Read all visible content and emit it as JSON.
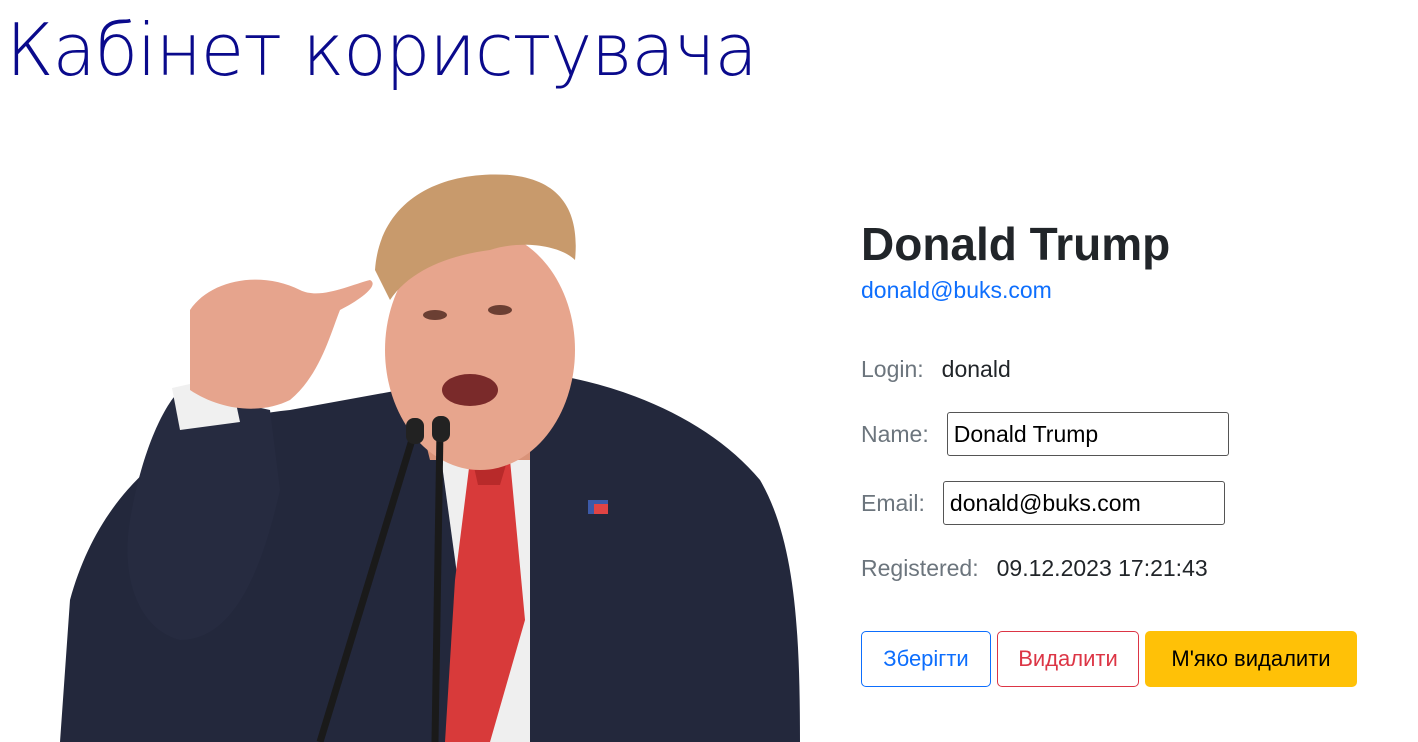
{
  "page": {
    "title": "Кабінет користувача"
  },
  "profile": {
    "name": "Donald Trump",
    "email_link": "donald@buks.com",
    "fields": {
      "login_label": "Login:",
      "login_value": "donald",
      "name_label": "Name:",
      "name_value": "Donald Trump",
      "email_label": "Email:",
      "email_value": "donald@buks.com",
      "registered_label": "Registered:",
      "registered_value": "09.12.2023 17:21:43"
    }
  },
  "actions": {
    "save_label": "Зберігти",
    "delete_label": "Видалити",
    "soft_delete_label": "М'яко видалити"
  },
  "colors": {
    "title": "#0a0a8c",
    "link": "#0d6efd",
    "save": "#0d6efd",
    "delete": "#dc3545",
    "soft_delete": "#ffc107"
  }
}
